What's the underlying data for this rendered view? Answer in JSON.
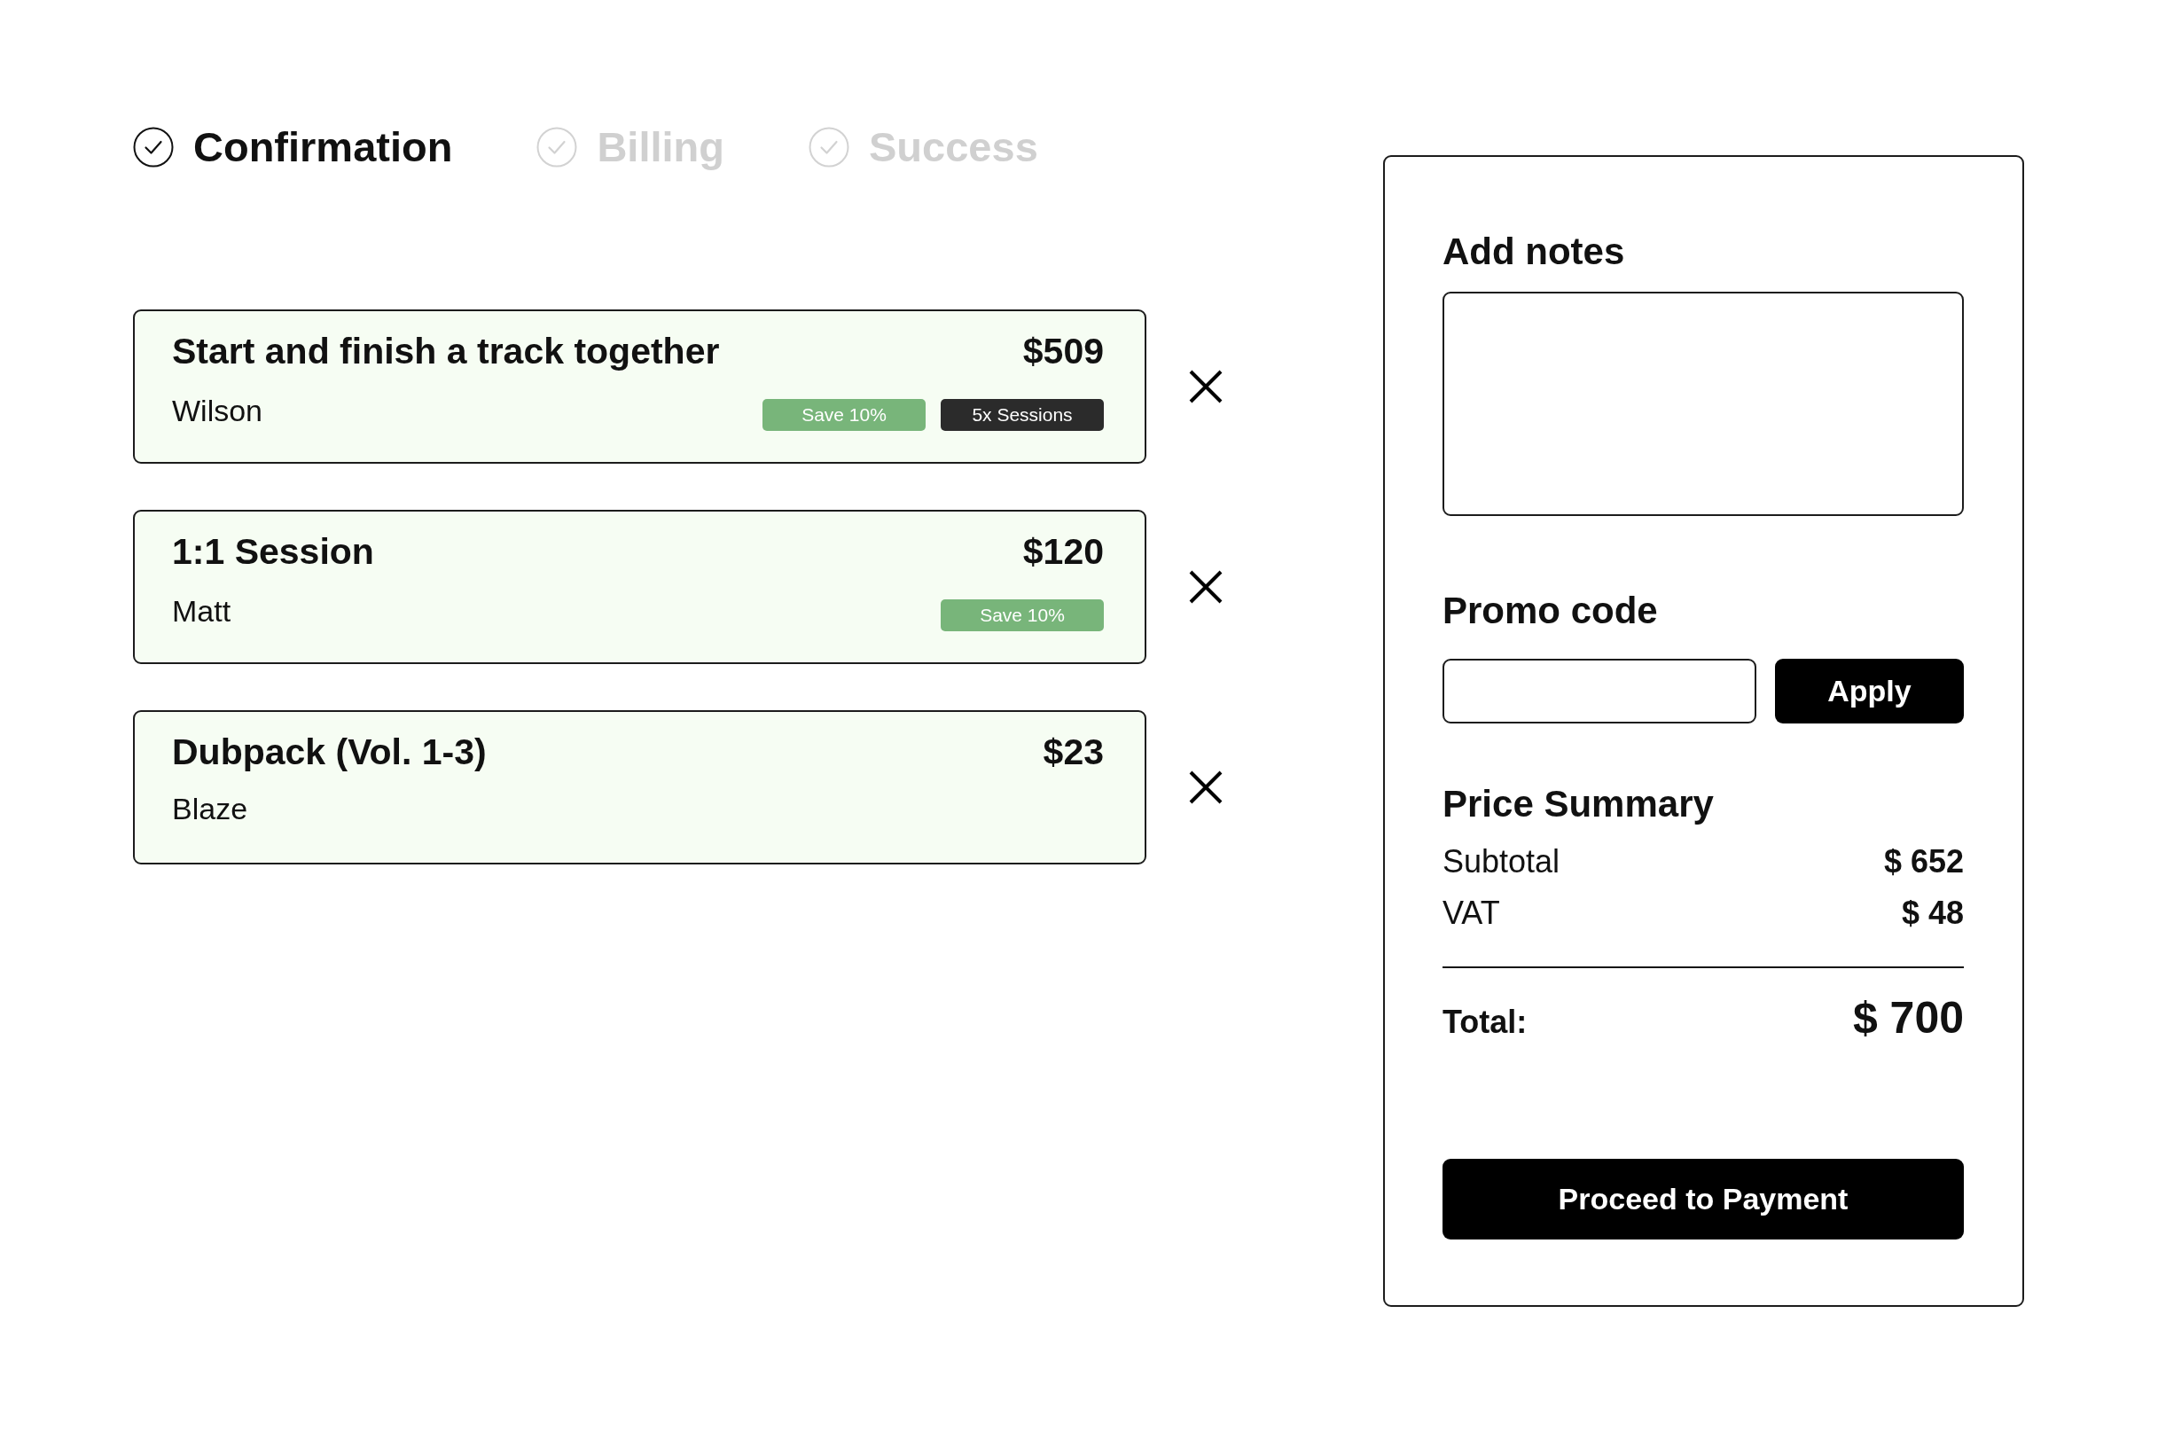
{
  "steps": [
    {
      "label": "Confirmation",
      "active": true
    },
    {
      "label": "Billing",
      "active": false
    },
    {
      "label": "Success",
      "active": false
    }
  ],
  "cart_items": [
    {
      "title": "Start and finish a track together",
      "artist": "Wilson",
      "price": "$509",
      "tags": [
        {
          "label": "Save 10%",
          "color": "#78b57a"
        },
        {
          "label": "5x Sessions",
          "color": "#2b2b2b"
        }
      ]
    },
    {
      "title": "1:1 Session",
      "artist": "Matt",
      "price": "$120",
      "tags": [
        {
          "label": "Save 10%",
          "color": "#78b57a"
        }
      ]
    },
    {
      "title": "Dubpack (Vol. 1-3)",
      "artist": "Blaze",
      "price": "$23"
    }
  ],
  "side_panel": {
    "notes": {
      "label": "Add notes"
    },
    "promo": {
      "label": "Promo code",
      "button": "Apply"
    },
    "summary": {
      "title": "Price Summary",
      "rows": [
        {
          "label": "Subtotal",
          "value": "$ 652"
        },
        {
          "label": "VAT",
          "value": "$ 48"
        }
      ],
      "total": {
        "label": "Total:",
        "value": "$ 700"
      }
    },
    "checkout_button": "Proceed to Payment"
  }
}
